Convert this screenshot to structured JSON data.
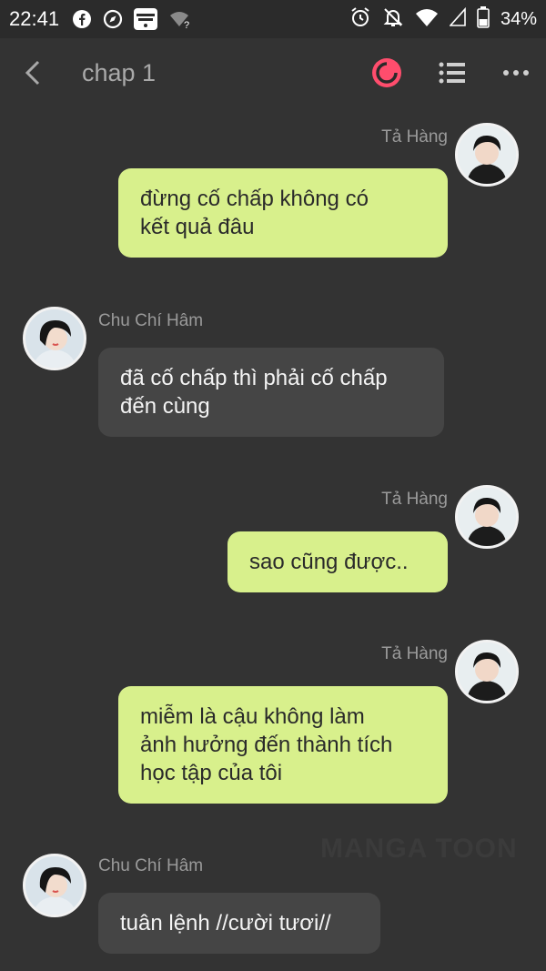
{
  "status_bar": {
    "time": "22:41",
    "icons_left": [
      "facebook-icon",
      "compass-icon",
      "mangatoon-icon",
      "wifi-question-icon"
    ],
    "icons_right": [
      "alarm-icon",
      "bell-off-icon",
      "wifi-icon",
      "signal-icon",
      "battery-icon"
    ],
    "battery": "34%"
  },
  "header": {
    "title": "chap 1",
    "actions": [
      "record-icon",
      "list-icon",
      "more-icon"
    ],
    "accent": "#ff4d6d"
  },
  "messages": [
    {
      "side": "right",
      "sender": "Tả Hàng",
      "text_lines": [
        "đừng cố chấp không có",
        "kết quả đâu"
      ]
    },
    {
      "side": "left",
      "sender": "Chu Chí Hâm",
      "text_lines": [
        "đã cố chấp thì phải cố chấp",
        "đến cùng"
      ]
    },
    {
      "side": "right",
      "sender": "Tả Hàng",
      "text_lines": [
        "sao cũng được.."
      ]
    },
    {
      "side": "right",
      "sender": "Tả Hàng",
      "text_lines": [
        "miễm là cậu không làm",
        "ảnh hưởng đến thành tích",
        "học tập của tôi"
      ]
    },
    {
      "side": "left",
      "sender": "Chu Chí Hâm",
      "text_lines": [
        "tuân lệnh //cười tươi//"
      ]
    }
  ],
  "watermark": "MANGA TOON",
  "colors": {
    "bubble_right": "#d8f08c",
    "bubble_left": "#454545",
    "background": "#333333"
  }
}
